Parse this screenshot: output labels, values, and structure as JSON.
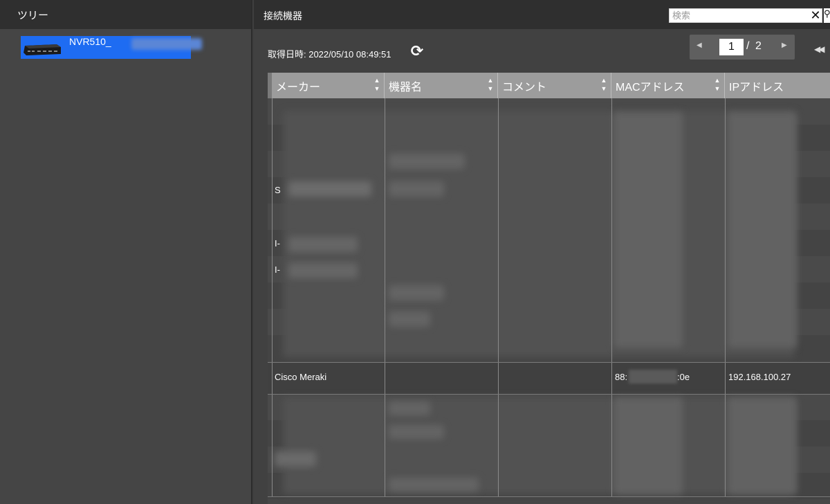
{
  "tree": {
    "title": "ツリー",
    "node_label": "NVR510_"
  },
  "main": {
    "title": "接続機器",
    "search_placeholder": "検索",
    "fetch_time": "取得日時: 2022/05/10 08:49:51",
    "pager": {
      "current": "1",
      "separator": "/",
      "total": "2"
    }
  },
  "table": {
    "columns": [
      {
        "label": "メーカー"
      },
      {
        "label": "機器名"
      },
      {
        "label": "コメント"
      },
      {
        "label": "MACアドレス"
      },
      {
        "label": "IPアドレス"
      }
    ],
    "partial_rows": [
      "S",
      "I-",
      "I-"
    ],
    "highlight_row": {
      "maker": "Cisco Meraki",
      "device_name": "",
      "comment": "",
      "mac_prefix": "88:",
      "mac_suffix": ":0e",
      "ip": "192.168.100.27"
    }
  },
  "icons": {
    "refresh": "refresh-icon",
    "clear": "close-icon",
    "search": "search-icon",
    "pager_prev": "triangle-left-icon",
    "pager_next": "triangle-right-icon",
    "first_page": "double-left-icon",
    "sort": "sort-icon",
    "router": "router-icon"
  },
  "colors": {
    "selection": "#1e6cf2",
    "header_bar": "#2f2f2f",
    "table_header": "#9c9c9c"
  }
}
